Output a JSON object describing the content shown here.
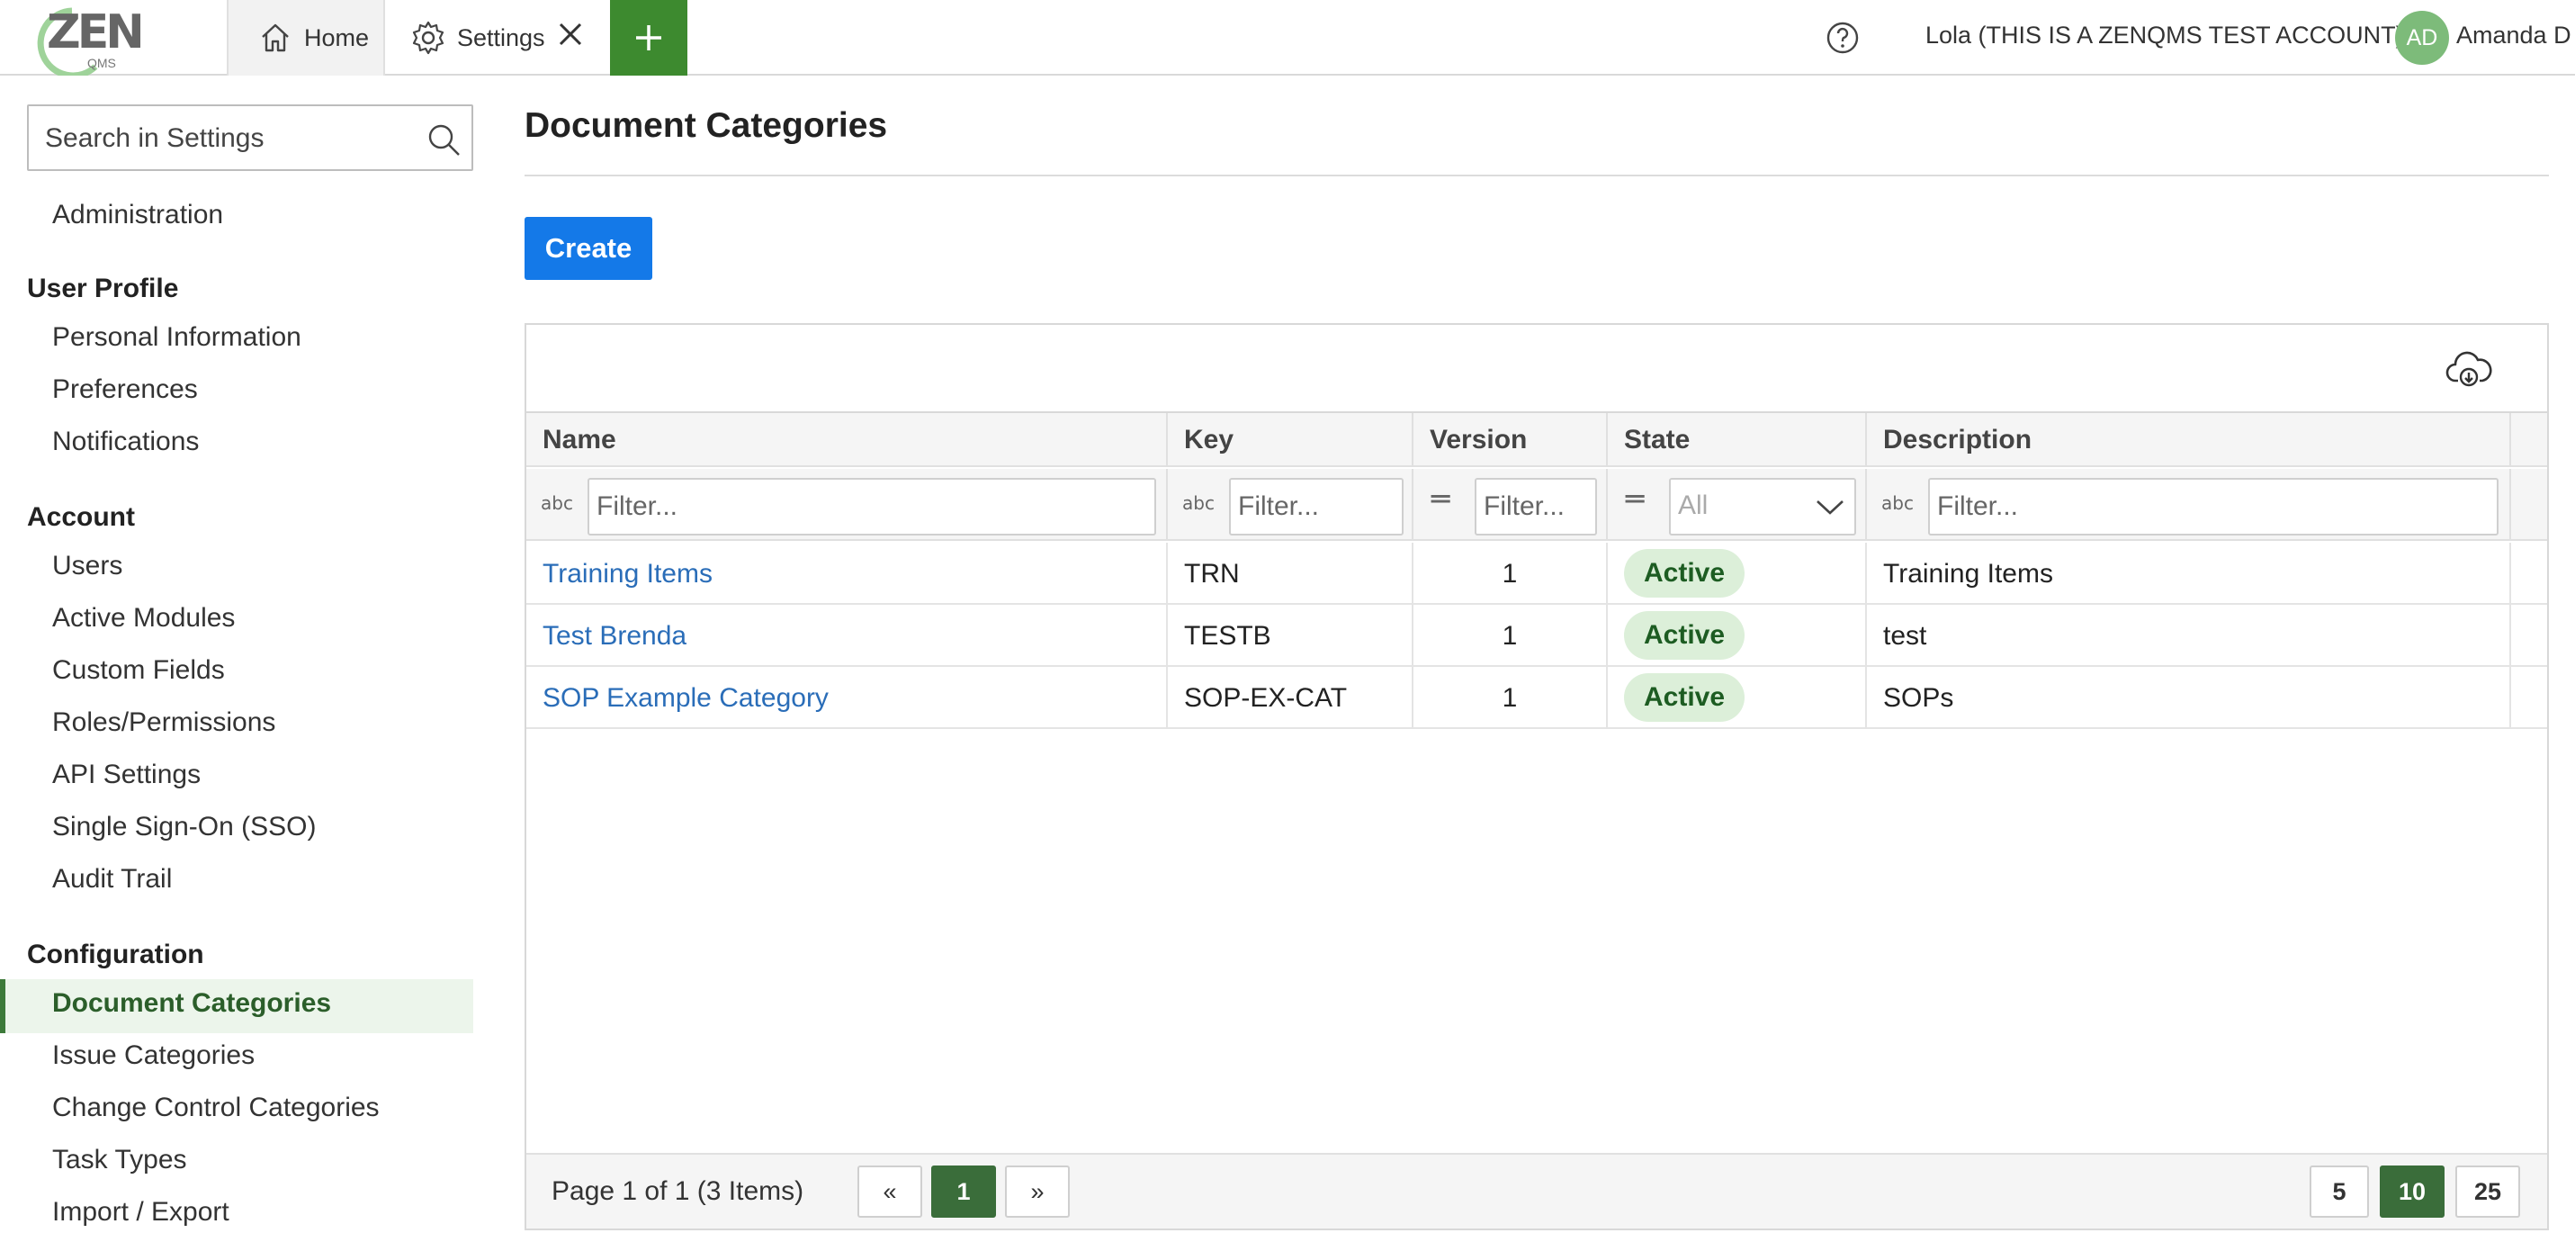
{
  "topbar": {
    "logo_text": "ZEN",
    "logo_sub": "QMS",
    "tabs": [
      {
        "label": "Home",
        "icon": "home-icon"
      },
      {
        "label": "Settings",
        "icon": "gear-icon"
      }
    ],
    "account_name": "Lola (THIS IS A ZENQMS TEST ACCOUNT)",
    "avatar_initials": "AD",
    "user_name": "Amanda D",
    "accent_color": "#3d8a2f"
  },
  "sidebar": {
    "search_placeholder": "Search in Settings",
    "administration": "Administration",
    "sections": [
      {
        "title": "User Profile",
        "items": [
          "Personal Information",
          "Preferences",
          "Notifications"
        ]
      },
      {
        "title": "Account",
        "items": [
          "Users",
          "Active Modules",
          "Custom Fields",
          "Roles/Permissions",
          "API Settings",
          "Single Sign-On (SSO)",
          "Audit Trail"
        ]
      },
      {
        "title": "Configuration",
        "items": [
          "Document Categories",
          "Issue Categories",
          "Change Control Categories",
          "Task Types",
          "Import / Export"
        ]
      }
    ],
    "active_item": "Document Categories"
  },
  "main": {
    "title": "Document Categories",
    "create_label": "Create",
    "columns": [
      "Name",
      "Key",
      "Version",
      "State",
      "Description"
    ],
    "filters": {
      "name_placeholder": "Filter...",
      "key_placeholder": "Filter...",
      "version_placeholder": "Filter...",
      "state_value": "All",
      "description_placeholder": "Filter...",
      "text_icon": "a͏b͏c",
      "eq_icon": "═"
    },
    "rows": [
      {
        "name": "Training Items",
        "key": "TRN",
        "version": "1",
        "state": "Active",
        "description": "Training Items"
      },
      {
        "name": "Test Brenda",
        "key": "TESTB",
        "version": "1",
        "state": "Active",
        "description": "test"
      },
      {
        "name": "SOP Example Category",
        "key": "SOP-EX-CAT",
        "version": "1",
        "state": "Active",
        "description": "SOPs"
      }
    ],
    "pager": {
      "info": "Page 1 of 1 (3 Items)",
      "prev": "«",
      "current": "1",
      "next": "»",
      "sizes": [
        "5",
        "10",
        "25"
      ],
      "active_size": "10"
    }
  }
}
